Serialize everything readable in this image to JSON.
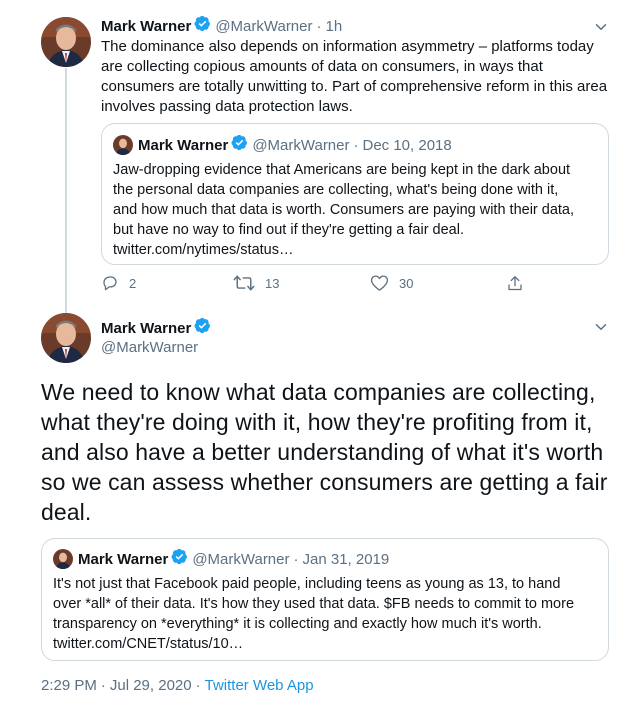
{
  "tweet1": {
    "author_name": "Mark Warner",
    "handle": "@MarkWarner",
    "time": "1h",
    "text": "The dominance also depends on information asymmetry – platforms today\nare collecting copious amounts of data on consumers, in ways that\nconsumers are totally unwitting to. Part of comprehensive reform in this area\ninvolves passing data protection laws.",
    "quote": {
      "author_name": "Mark Warner",
      "handle": "@MarkWarner",
      "date": "Dec 10, 2018",
      "text": "Jaw-dropping evidence that Americans are being kept in the dark about\nthe personal data companies are collecting, what's being done with it,\nand how much that data is worth. Consumers are paying with their data,\nbut have no way to find out if they're getting a fair deal.\ntwitter.com/nytimes/status…"
    },
    "actions": {
      "replies": "2",
      "retweets": "13",
      "likes": "30"
    }
  },
  "tweet2": {
    "author_name": "Mark Warner",
    "handle": "@MarkWarner",
    "text": "We need to know what data companies are collecting,\nwhat they're doing with it, how they're profiting from it,\nand also have a better understanding of what it's worth\nso we can assess whether consumers are getting a fair\ndeal.",
    "quote": {
      "author_name": "Mark Warner",
      "handle": "@MarkWarner",
      "date": "Jan 31, 2019",
      "text": "It's not just that Facebook paid people, including teens as young as 13, to hand\nover *all* of their data. It's how they used that data. $FB needs to commit to more\ntransparency on *everything* it is collecting and exactly how much it's worth.\ntwitter.com/CNET/status/10…"
    },
    "meta": {
      "time": "2:29 PM",
      "separator1": "·",
      "date": "Jul 29, 2020",
      "separator2": "·",
      "source": "Twitter Web App"
    }
  },
  "separator": "·",
  "icons": [
    "verified-badge-icon",
    "chevron-down-icon",
    "reply-icon",
    "retweet-icon",
    "like-icon",
    "share-icon"
  ],
  "colors": {
    "accent": "#1da1f2",
    "muted": "#5b7083",
    "border": "#cfd9de",
    "link": "#1b95e0"
  }
}
